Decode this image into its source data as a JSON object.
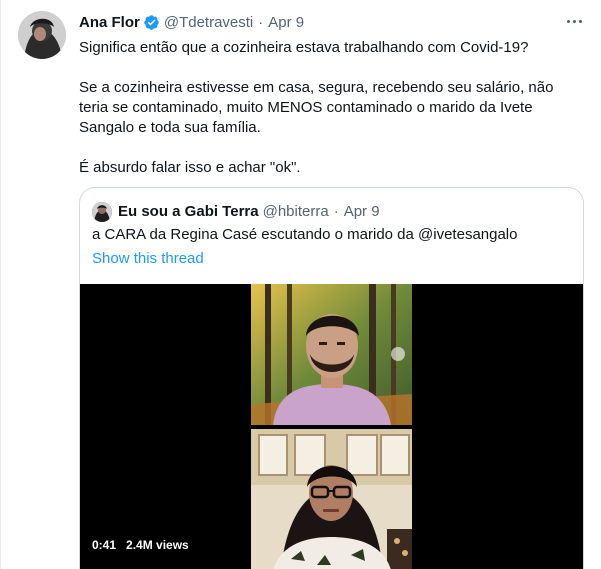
{
  "tweet": {
    "author_name": "Ana Flor",
    "author_handle": "@Tdetravesti",
    "separator": "·",
    "date": "Apr 9",
    "paragraphs": [
      "Significa então que a cozinheira estava trabalhando com Covid-19?",
      "Se a cozinheira estivesse em casa, segura, recebendo seu salário, não teria se contaminado, muito MENOS contaminado o marido da Ivete Sangalo e toda sua família.",
      "É absurdo falar isso e achar \"ok\"."
    ]
  },
  "quoted": {
    "author_name": "Eu sou a Gabi Terra",
    "author_handle": "@hbiterra",
    "separator": "·",
    "date": "Apr 9",
    "text": "a CARA da Regina Casé escutando o marido da @ivetesangalo",
    "show_thread": "Show this thread",
    "video": {
      "duration": "0:41",
      "views": "2.4M views"
    }
  },
  "colors": {
    "accent": "#1d9bf0",
    "text": "#0f1419",
    "muted": "#536471",
    "border": "#cfd9de"
  },
  "icons": [
    "verified-badge-icon",
    "more-options-icon"
  ]
}
